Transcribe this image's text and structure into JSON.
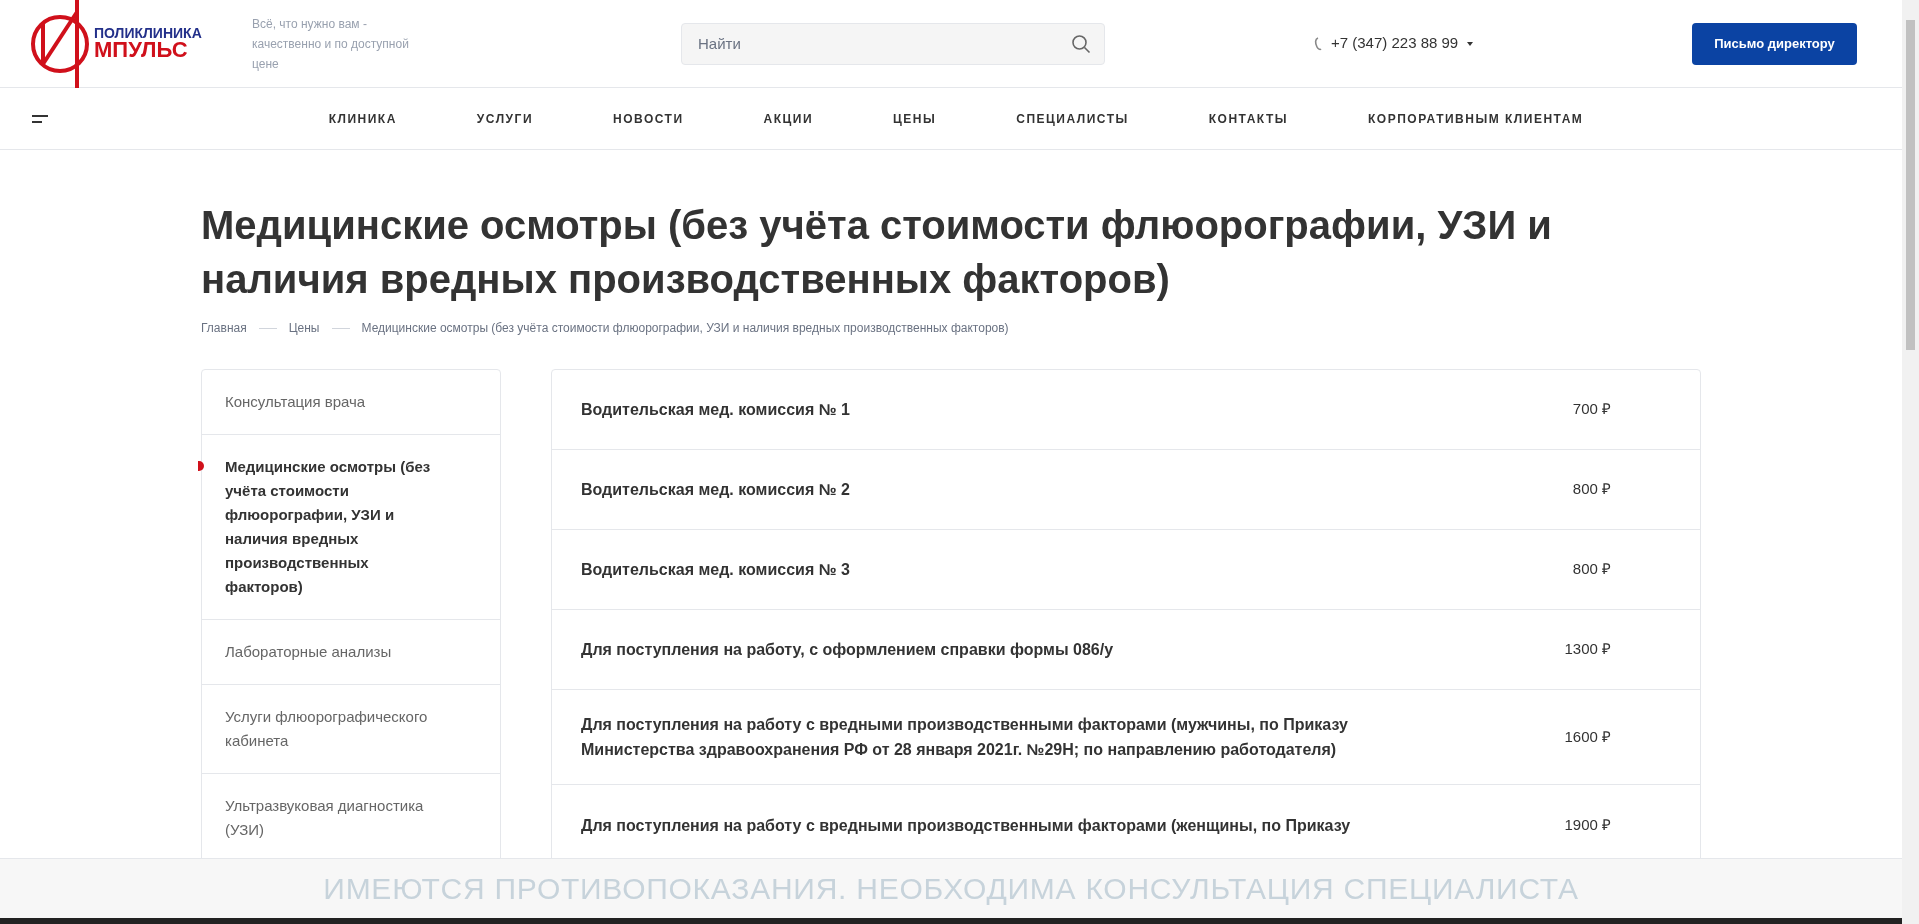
{
  "logo": {
    "top": "ПОЛИКЛИНИКА",
    "bottom": "МПУЛЬС"
  },
  "tagline": "Всё, что нужно вам - качественно и по доступной цене",
  "search": {
    "placeholder": "Найти"
  },
  "phone": "+7 (347) 223 88 99",
  "cta_button": "Письмо директору",
  "nav": [
    "КЛИНИКА",
    "УСЛУГИ",
    "НОВОСТИ",
    "АКЦИИ",
    "ЦЕНЫ",
    "СПЕЦИАЛИСТЫ",
    "КОНТАКТЫ",
    "КОРПОРАТИВНЫМ КЛИЕНТАМ"
  ],
  "title": "Медицинские осмотры (без учёта стоимости флюорографии, УЗИ и наличия вредных производственных факторов)",
  "breadcrumbs": [
    "Главная",
    "Цены",
    "Медицинские осмотры (без учёта стоимости флюорографии, УЗИ и наличия вредных производственных факторов)"
  ],
  "sidebar": [
    {
      "label": "Консультация врача",
      "selected": false
    },
    {
      "label": "Медицинские осмотры (без учёта стоимости флюорографии, УЗИ и наличия вредных производственных факторов)",
      "selected": true
    },
    {
      "label": "Лабораторные анализы",
      "selected": false
    },
    {
      "label": "Услуги флюорографического кабинета",
      "selected": false
    },
    {
      "label": "Ультразвуковая диагностика (УЗИ)",
      "selected": false
    }
  ],
  "prices": [
    {
      "name": "Водительская мед. комиссия № 1",
      "price": "700 ₽"
    },
    {
      "name": "Водительская мед. комиссия № 2",
      "price": "800 ₽"
    },
    {
      "name": "Водительская мед. комиссия № 3",
      "price": "800 ₽"
    },
    {
      "name": "Для поступления на работу, с оформлением справки формы 086/у",
      "price": "1300 ₽"
    },
    {
      "name": "Для поступления на работу с вредными производственными факторами (мужчины, по Приказу Министерства здравоохранения РФ от 28 января 2021г. №29Н; по направлению работодателя)",
      "price": "1600 ₽"
    },
    {
      "name": "Для поступления на работу с вредными производственными факторами (женщины, по Приказу",
      "price": "1900 ₽"
    }
  ],
  "banner": "ИМЕЮТСЯ ПРОТИВОПОКАЗАНИЯ. НЕОБХОДИМА КОНСУЛЬТАЦИЯ СПЕЦИАЛИСТА"
}
